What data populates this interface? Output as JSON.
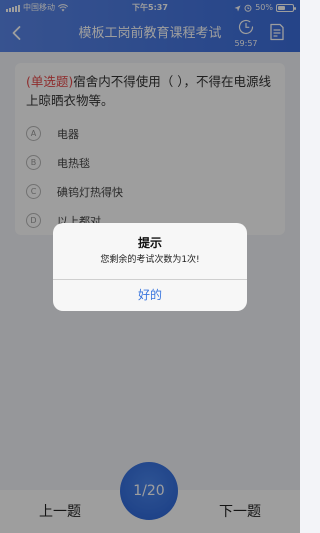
{
  "status_bar": {
    "carrier": "中国移动",
    "time": "下午5:37",
    "battery": "50%",
    "battery_level": 0.5,
    "icons": [
      "signal-icon",
      "wifi-icon",
      "location-icon",
      "alarm-icon",
      "battery-icon"
    ]
  },
  "nav": {
    "back_icon": "chevron-left-icon",
    "title": "模板工岗前教育课程考试",
    "timer_icon": "clock-icon",
    "timer": "59:57",
    "sheet_icon": "answer-sheet-icon"
  },
  "question": {
    "type_label": "(单选题)",
    "text": "宿舍内不得使用（ ），不得在电源线上晾晒衣物等。",
    "options": [
      {
        "letter": "A",
        "text": "电器"
      },
      {
        "letter": "B",
        "text": "电热毯"
      },
      {
        "letter": "C",
        "text": "碘钨灯热得快"
      },
      {
        "letter": "D",
        "text": "以上都对"
      }
    ]
  },
  "alert": {
    "title": "提示",
    "message": "您剩余的考试次数为1次!",
    "ok_label": "好的"
  },
  "footer": {
    "prev_label": "上一题",
    "next_label": "下一题",
    "progress": "1/20"
  },
  "colors": {
    "header_gradient_start": "#5a86e8",
    "header_gradient_end": "#3c6edc",
    "question_type": "#e64a4a",
    "alert_button": "#3a76de",
    "progress_circle": "#2a63d6"
  }
}
